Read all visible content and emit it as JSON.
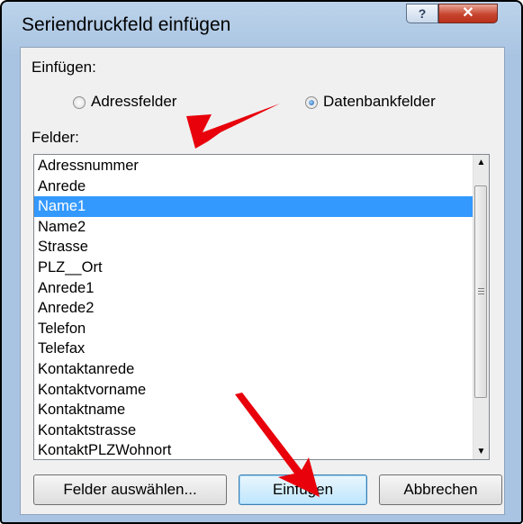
{
  "window": {
    "title": "Seriendruckfeld einfügen"
  },
  "titlebar": {
    "help_icon": "?",
    "close_icon": "✕"
  },
  "insert_section": {
    "label": "Einfügen:",
    "radio_address": {
      "label": "Adressfelder",
      "checked": false
    },
    "radio_database": {
      "label": "Datenbankfelder",
      "checked": true
    }
  },
  "fields": {
    "label": "Felder:",
    "items": [
      "Adressnummer",
      "Anrede",
      "Name1",
      "Name2",
      "Strasse",
      "PLZ__Ort",
      "Anrede1",
      "Anrede2",
      "Telefon",
      "Telefax",
      "Kontaktanrede",
      "Kontaktvorname",
      "Kontaktname",
      "Kontaktstrasse",
      "KontaktPLZWohnort"
    ],
    "selected_index": 2
  },
  "buttons": {
    "select_fields": "Felder auswählen...",
    "insert": "Einfügen",
    "cancel": "Abbrechen"
  },
  "annotation_color": "#e8000b"
}
